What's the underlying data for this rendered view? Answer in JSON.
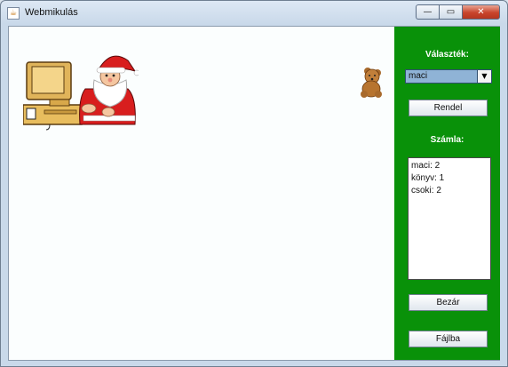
{
  "window": {
    "title": "Webmikulás",
    "min_glyph": "—",
    "max_glyph": "▭",
    "close_glyph": "✕"
  },
  "sidebar": {
    "choice_label": "Választék:",
    "combo": {
      "selected": "maci"
    },
    "order_button": "Rendel",
    "bill_label": "Számla:",
    "bill_items": [
      "maci: 2",
      "könyv: 1",
      "csoki: 2"
    ],
    "close_button": "Bezár",
    "file_button": "Fájlba"
  },
  "colors": {
    "sidebar": "#099109",
    "canvas": "#fbfefe"
  },
  "images": {
    "main": "santa-at-computer-illustration",
    "product": "teddy-bear-icon"
  }
}
